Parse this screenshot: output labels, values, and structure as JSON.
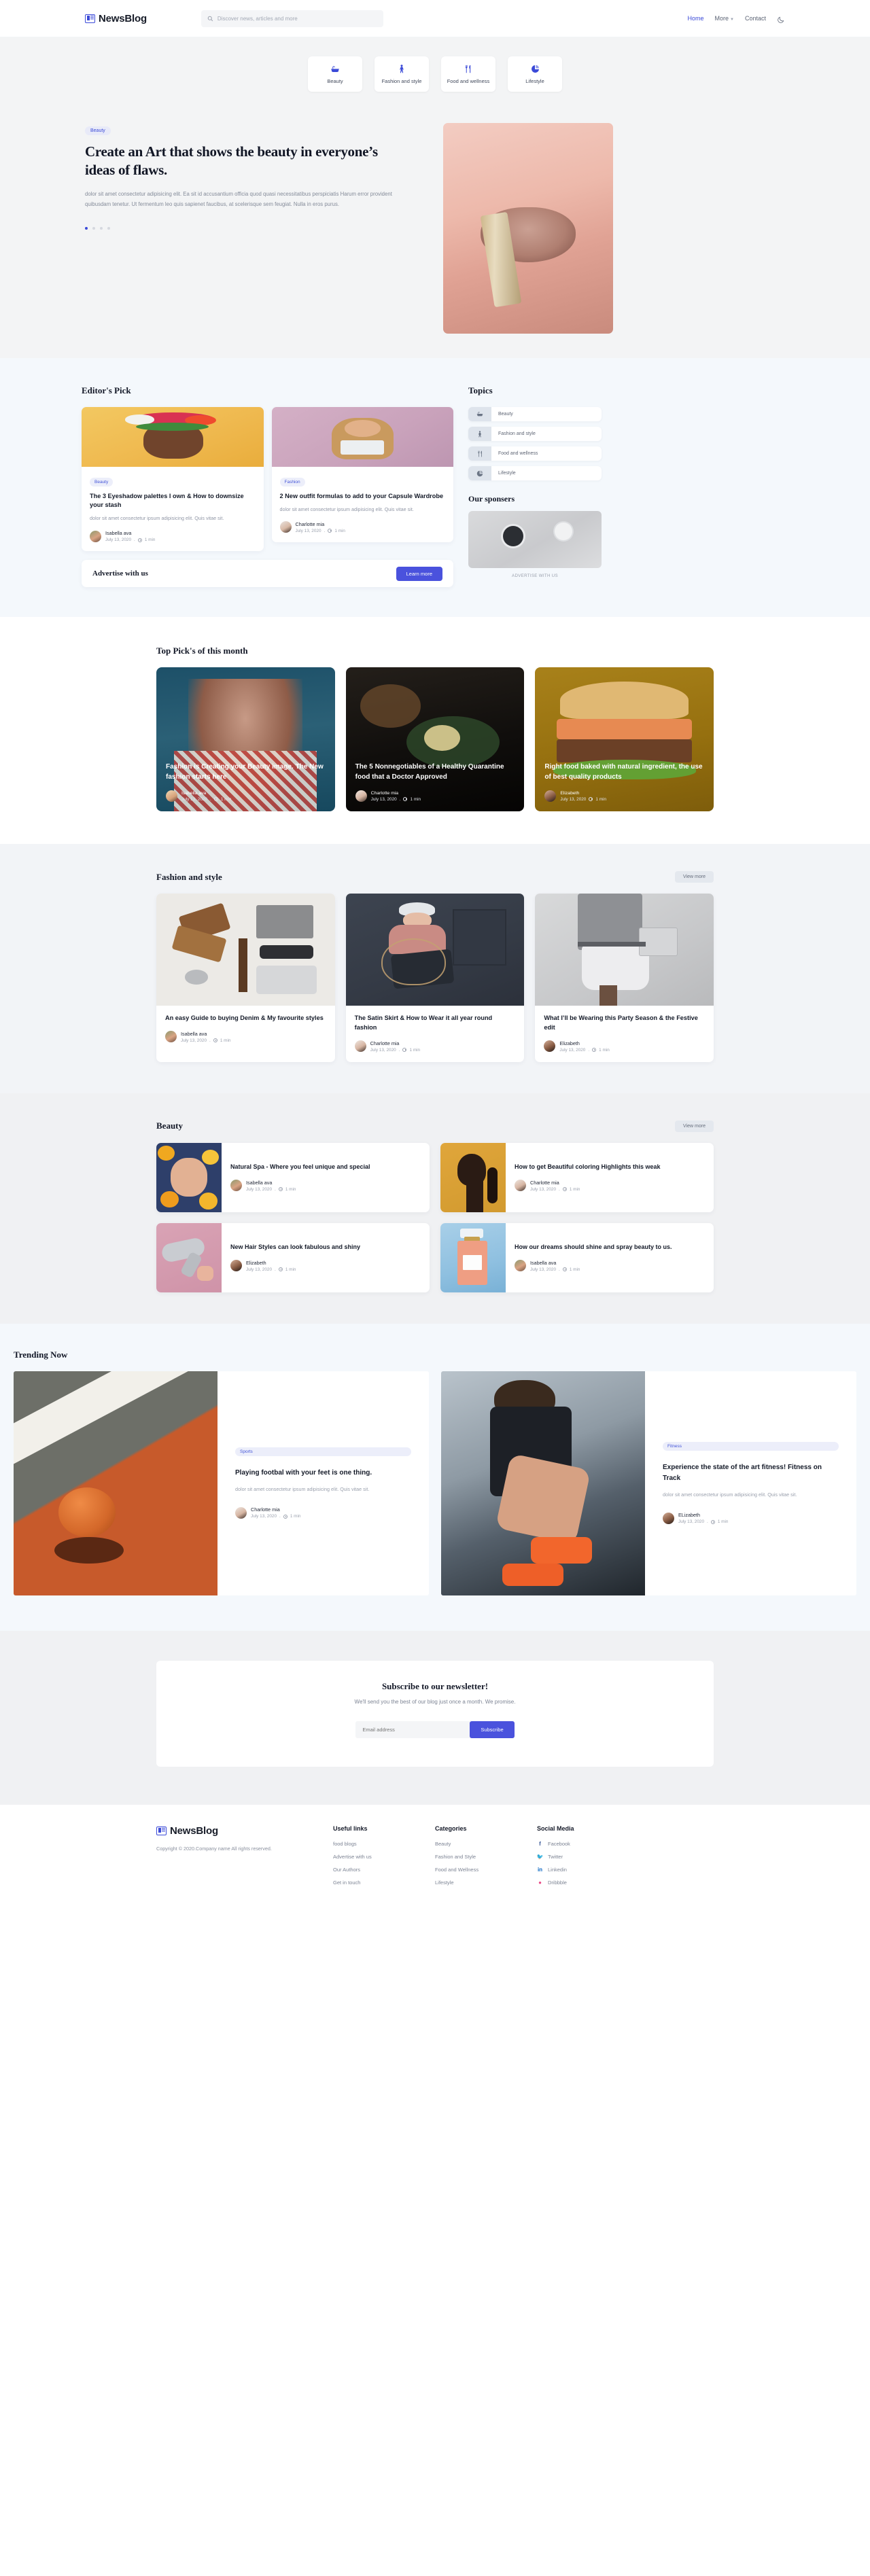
{
  "brand": {
    "name": "NewsBlog",
    "logo_icon": "newspaper-icon"
  },
  "header": {
    "search": {
      "placeholder": "Discover news, articles and more",
      "icon": "search-icon"
    },
    "nav": [
      {
        "label": "Home",
        "active": true
      },
      {
        "label": "More",
        "caret": "⌄"
      },
      {
        "label": "Contact",
        "active": false
      }
    ],
    "theme_toggle_icon": "moon-icon"
  },
  "hero": {
    "categories": [
      {
        "label": "Beauty",
        "icon": "bathtub-icon"
      },
      {
        "label": "Fashion and style",
        "icon": "person-dress-icon"
      },
      {
        "label": "Food and wellness",
        "icon": "fork-knife-icon"
      },
      {
        "label": "Lifestyle",
        "icon": "pie-chart-icon"
      }
    ],
    "tag": "Beauty",
    "title": "Create an Art that shows the beauty in everyone’s ideas of flaws.",
    "description": "dolor sit amet consectetur adipisicing elit. Ea sit id accusantium officia quod quasi necessitatibus perspiciatis Harum error provident quibusdam tenetur. Ut fermentum leo quis sapienet faucibus, at scelerisque sem feugiat. Nulla in eros purus.",
    "dots": 4,
    "active_dot": 0,
    "image_alt": "woman applying lipstick"
  },
  "editors": {
    "title": "Editor's Pick",
    "cards": [
      {
        "tag": "Beauty",
        "title": "The 3 Eyeshadow palettes I own & How to downsize your stash",
        "desc": "dolor sit amet consectetur ipsum adipisicing elit. Quis vitae sit.",
        "author": "Isabella ava",
        "date": "July 13, 2020",
        "read": "1 min"
      },
      {
        "tag": "Fashion",
        "title": "2 New outfit formulas to add to your Capsule Wardrobe",
        "desc": "dolor sit amet consectetur ipsum adipisicing elit. Quis vitae sit.",
        "author": "Charlotte mia",
        "date": "July 13, 2020",
        "read": "1 min"
      }
    ],
    "advertise": {
      "title": "Advertise with us",
      "button": "Learn more"
    },
    "topics_title": "Topics",
    "topics": [
      {
        "label": "Beauty",
        "icon": "bathtub-icon"
      },
      {
        "label": "Fashion and style",
        "icon": "person-dress-icon"
      },
      {
        "label": "Food and wellness",
        "icon": "fork-knife-icon"
      },
      {
        "label": "Lifestyle",
        "icon": "pie-chart-icon"
      }
    ],
    "sponsors_title": "Our sponsers",
    "sponsor_caption": "ADVERTISE WITH US"
  },
  "top_picks": {
    "title": "Top Pick's of this month",
    "cards": [
      {
        "title": "Fashion is Creating your Beauty image. The New fashion starts here",
        "author": "Isabella ava",
        "date": "July 13, 2020",
        "read": "1 min",
        "bg": "#1d5068"
      },
      {
        "title": "The 5 Nonnegotiables of a Healthy Quarantine food that a Doctor Approved",
        "author": "Charlotte mia",
        "date": "July 13, 2020",
        "read": "1 min",
        "bg": "#191714"
      },
      {
        "title": "Right food baked with natural ingredient, the use of best quality products",
        "author": "Elizabeth",
        "date": "July 13, 2020",
        "read": "1 min",
        "bg": "#9a7712"
      }
    ]
  },
  "fashion": {
    "title": "Fashion and style",
    "view_more": "View more",
    "cards": [
      {
        "title": "An easy Guide to buying Denim & My favourite styles",
        "author": "Isabella ava",
        "date": "July 13, 2020",
        "read": "1 min"
      },
      {
        "title": "The Satin Skirt & How to Wear it all year round fashion",
        "author": "Charlotte mia",
        "date": "July 13, 2020",
        "read": "1 min"
      },
      {
        "title": "What I’ll be Wearing this Party Season & the Festive edit",
        "author": "Elizabeth",
        "date": "July 13, 2020",
        "read": "1 min"
      }
    ]
  },
  "beauty": {
    "title": "Beauty",
    "view_more": "View more",
    "cards": [
      {
        "title": "Natural Spa - Where you feel unique and special",
        "author": "Isabella ava",
        "date": "July 13, 2020",
        "read": "1 min"
      },
      {
        "title": "How to get Beautiful coloring Highlights this weak",
        "author": "Charlotte mia",
        "date": "July 13, 2020",
        "read": "1 min"
      },
      {
        "title": "New Hair Styles can look fabulous and shiny",
        "author": "Elizabeth",
        "date": "July 13, 2020",
        "read": "1 min"
      },
      {
        "title": "How our dreams should shine and spray beauty to us.",
        "author": "Isabella ava",
        "date": "July 13, 2020",
        "read": "1 min"
      }
    ]
  },
  "trending": {
    "title": "Trending Now",
    "cards": [
      {
        "tag": "Sports",
        "title": "Playing footbal with your feet is one thing.",
        "desc": "dolor sit amet consectetur ipsum adipisicing elit. Quis vitae sit.",
        "author": "Charlotte mia",
        "date": "July 13, 2020",
        "read": "1 min"
      },
      {
        "tag": "Fitness",
        "title": "Experience the state of the art fitness! Fitness on Track",
        "desc": "dolor sit amet consectetur ipsum adipisicing elit. Quis vitae sit.",
        "author": "ELizabeth",
        "date": "July 13, 2020",
        "read": "1 min"
      }
    ]
  },
  "newsletter": {
    "title": "Subscribe to our newsletter!",
    "subtitle": "We'll send you the best of our blog just once a month. We promise.",
    "placeholder": "Email address",
    "button": "Subscribe"
  },
  "footer": {
    "copyright": "Copyright © 2020.Company name All rights reserved.",
    "columns": [
      {
        "heading": "Useful links",
        "links": [
          "food blogs",
          "Advertise with us",
          "Our Authors",
          "Get in touch"
        ]
      },
      {
        "heading": "Categories",
        "links": [
          "Beauty",
          "Fashion and Style",
          "Food and Wellness",
          "Lifestyle"
        ]
      }
    ],
    "social_heading": "Social Media",
    "social": [
      {
        "label": "Facebook",
        "icon": "facebook-icon",
        "color": "#3b5998"
      },
      {
        "label": "Twitter",
        "icon": "twitter-icon",
        "color": "#1da1f2"
      },
      {
        "label": "Linkedin",
        "icon": "linkedin-icon",
        "color": "#0a66c2"
      },
      {
        "label": "Dribbble",
        "icon": "dribbble-icon",
        "color": "#ea4c89"
      }
    ]
  },
  "colors": {
    "accent": "#4a52dd",
    "chip_bg": "#e8eaf8",
    "text": "#131827",
    "muted": "#9aa0ad"
  }
}
